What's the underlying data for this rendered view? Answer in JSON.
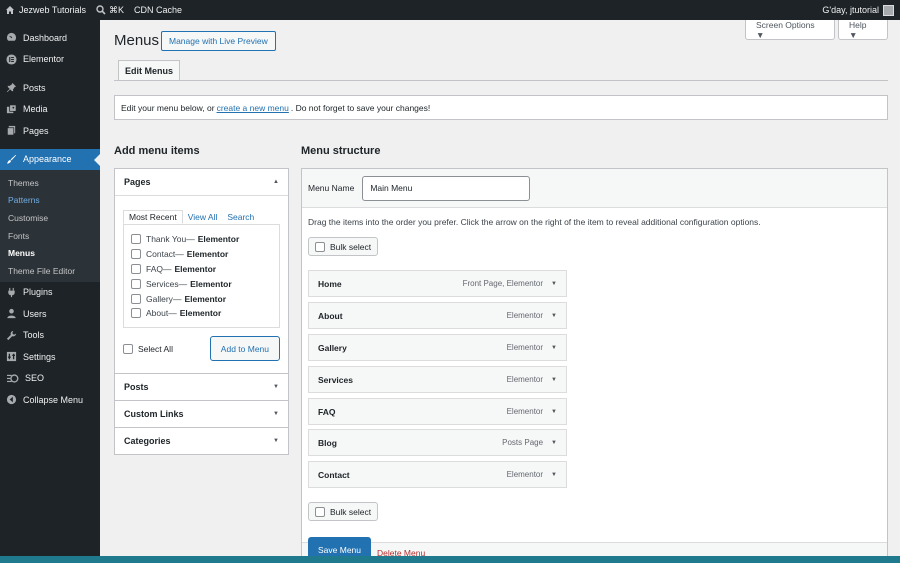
{
  "adminbar": {
    "site_name": "Jezweb Tutorials",
    "search_shortcut": "⌘K",
    "cdn_cache": "CDN Cache",
    "greeting": "G'day, jtutorial"
  },
  "sidebar": {
    "dashboard": "Dashboard",
    "elementor": "Elementor",
    "posts": "Posts",
    "media": "Media",
    "pages": "Pages",
    "appearance": "Appearance",
    "sub": [
      "Themes",
      "Patterns",
      "Customise",
      "Fonts",
      "Menus",
      "Theme File Editor"
    ],
    "plugins": "Plugins",
    "users": "Users",
    "tools": "Tools",
    "settings": "Settings",
    "seo": "SEO",
    "collapse": "Collapse Menu"
  },
  "header": {
    "title": "Menus",
    "live_preview": "Manage with Live Preview",
    "screen_options": "Screen Options ▼",
    "help": "Help ▼",
    "tab": "Edit Menus"
  },
  "notice": {
    "before": "Edit your menu below, or",
    "link": "create a new menu",
    "after": ". Do not forget to save your changes!"
  },
  "add_items": {
    "heading": "Add menu items",
    "pages_title": "Pages",
    "tabs": [
      "Most Recent",
      "View All",
      "Search"
    ],
    "pages": [
      {
        "title": "Thank You",
        "type": "Elementor"
      },
      {
        "title": "Contact",
        "type": "Elementor"
      },
      {
        "title": "FAQ",
        "type": "Elementor"
      },
      {
        "title": "Services",
        "type": "Elementor"
      },
      {
        "title": "Gallery",
        "type": "Elementor"
      },
      {
        "title": "About",
        "type": "Elementor"
      }
    ],
    "dash": " — ",
    "select_all": "Select All",
    "add_button": "Add to Menu",
    "posts": "Posts",
    "custom_links": "Custom Links",
    "categories": "Categories"
  },
  "structure": {
    "heading": "Menu structure",
    "menu_name_label": "Menu Name",
    "menu_name_value": "Main Menu",
    "instructions": "Drag the items into the order you prefer. Click the arrow on the right of the item to reveal additional configuration options.",
    "bulk_select": "Bulk select",
    "items": [
      {
        "title": "Home",
        "type": "Front Page, Elementor"
      },
      {
        "title": "About",
        "type": "Elementor"
      },
      {
        "title": "Gallery",
        "type": "Elementor"
      },
      {
        "title": "Services",
        "type": "Elementor"
      },
      {
        "title": "FAQ",
        "type": "Elementor"
      },
      {
        "title": "Blog",
        "type": "Posts Page"
      },
      {
        "title": "Contact",
        "type": "Elementor"
      }
    ],
    "save": "Save Menu",
    "delete": "Delete Menu"
  },
  "colors": {
    "accent": "#2271b1",
    "admin_dark": "#1d2327",
    "delete": "#b32d2e"
  }
}
